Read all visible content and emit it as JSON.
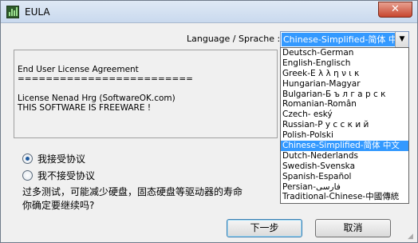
{
  "window": {
    "title": "EULA",
    "close_label": "✕"
  },
  "language": {
    "label": "Language / Sprache :",
    "selected": "Chinese-Simplified-简体 中文",
    "options": [
      "Deutsch-German",
      "English-Englisch",
      "Greek-Ε λ λ η ν ι κ",
      "Hungarian-Magyar",
      "Bulgarian-Б ъ л г а р с к",
      "Romanian-Român",
      "Czech- eský",
      "Russian-Р у с с к и й",
      "Polish-Polski",
      "Chinese-Simplified-简体 中文",
      "Dutch-Nederlands",
      "Swedish-Svenska",
      "Spanish-Español",
      "Persian-فارسی",
      "Traditional-Chinese-中國傳統"
    ],
    "selected_index": 9
  },
  "eula": {
    "heading": "End User License Agreement",
    "separator": "=========================",
    "license": "License Nenad Hrg (SoftwareOK.com)",
    "freeware": "THIS SOFTWARE IS FREEWARE !"
  },
  "options": {
    "accept": "我接受协议",
    "decline": "我不接受协议",
    "accept_checked": true
  },
  "warning": {
    "line1": "过多测试，可能减少硬盘，固态硬盘等驱动器的寿命",
    "line2": "你确定要继续吗?"
  },
  "buttons": {
    "next": "下一步",
    "cancel": "取消"
  }
}
